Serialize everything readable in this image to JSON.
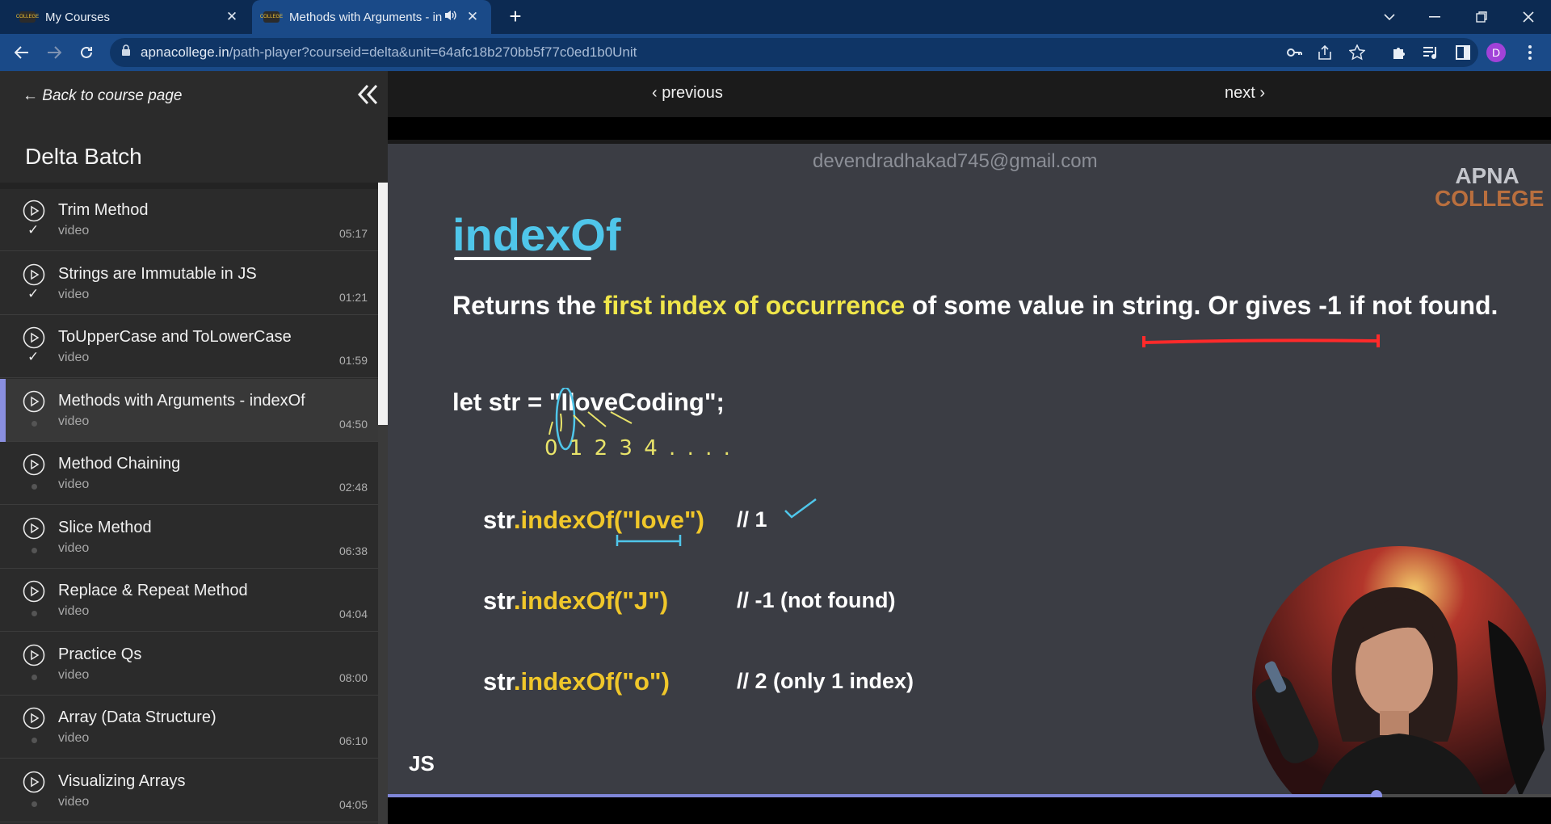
{
  "browser": {
    "tabs": [
      {
        "title": "My Courses",
        "active": false
      },
      {
        "title": "Methods with Arguments - in",
        "active": true
      }
    ],
    "url": {
      "host": "apnacollege.in",
      "path": "/path-player?courseid=delta&unit=64afc18b270bb5f77c0ed1b0Unit"
    },
    "profile_initial": "D",
    "favicon_text": "COLLEGE"
  },
  "sidebar": {
    "back_label": "← Back to course page",
    "course_title": "Delta Batch",
    "lessons": [
      {
        "title": "Trim Method",
        "type": "video",
        "duration": "05:17",
        "completed": true
      },
      {
        "title": "Strings are Immutable in JS",
        "type": "video",
        "duration": "01:21",
        "completed": true
      },
      {
        "title": "ToUpperCase and ToLowerCase",
        "type": "video",
        "duration": "01:59",
        "completed": true
      },
      {
        "title": "Methods with Arguments - indexOf",
        "type": "video",
        "duration": "04:50",
        "completed": false,
        "active": true
      },
      {
        "title": "Method Chaining",
        "type": "video",
        "duration": "02:48",
        "completed": false
      },
      {
        "title": "Slice Method",
        "type": "video",
        "duration": "06:38",
        "completed": false
      },
      {
        "title": "Replace & Repeat Method",
        "type": "video",
        "duration": "04:04",
        "completed": false
      },
      {
        "title": "Practice Qs",
        "type": "video",
        "duration": "08:00",
        "completed": false
      },
      {
        "title": "Array (Data Structure)",
        "type": "video",
        "duration": "06:10",
        "completed": false
      },
      {
        "title": "Visualizing Arrays",
        "type": "video",
        "duration": "04:05",
        "completed": false
      }
    ],
    "check_glyph": "✓"
  },
  "pager": {
    "previous": "‹ previous",
    "next": "next ›"
  },
  "video": {
    "watermark": "devendradhakad745@gmail.com",
    "brand_line1": "APNA",
    "brand_line2": "COLLEGE",
    "slide_title": "indexOf",
    "desc_before": "Returns the ",
    "desc_highlight": "first index of occurrence",
    "desc_after": " of some value in string. Or gives -1 if not found.",
    "declaration": "let str = \"IloveCoding\";",
    "handwritten_indices": "0 1 2 3 4 . . . .",
    "examples": [
      {
        "obj": "str",
        "method": ".indexOf(\"love\")",
        "comment": "// 1"
      },
      {
        "obj": "str",
        "method": ".indexOf(\"J\")",
        "comment": "// -1 (not found)"
      },
      {
        "obj": "str",
        "method": ".indexOf(\"o\")",
        "comment": "// 2 (only 1 index)"
      }
    ],
    "footer_label": "JS",
    "progress_fraction": 0.85
  },
  "colors": {
    "accent": "#7f86d8",
    "title_cyan": "#4fc6ea",
    "highlight_yellow": "#f0e64a",
    "browser_blue": "#1a4a88"
  }
}
